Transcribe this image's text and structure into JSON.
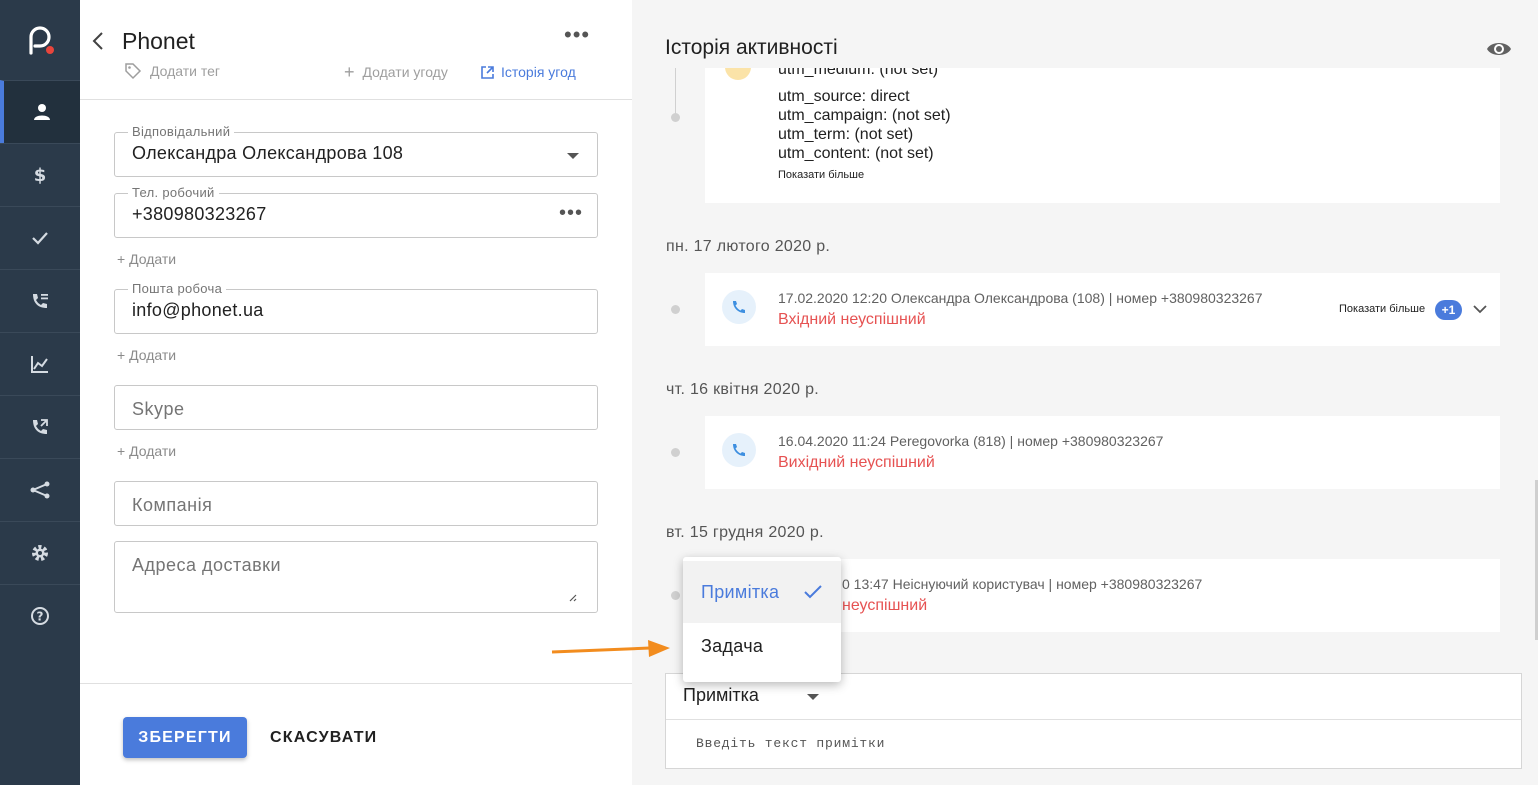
{
  "nav": {
    "items": [
      {
        "icon": "person-icon",
        "active": true
      },
      {
        "icon": "dollar-icon",
        "active": false
      },
      {
        "icon": "check-icon",
        "active": false
      },
      {
        "icon": "call-list-icon",
        "active": false
      },
      {
        "icon": "chart-icon",
        "active": false
      },
      {
        "icon": "call-forward-icon",
        "active": false
      },
      {
        "icon": "branch-icon",
        "active": false
      },
      {
        "icon": "gear-icon",
        "active": false
      },
      {
        "icon": "help-icon",
        "active": false
      }
    ],
    "accent": "#4a7bdc",
    "background": "#2b3a4a"
  },
  "contact": {
    "title": "Phonet",
    "add_tag": "Додати тег",
    "add_deal": "Додати угоду",
    "deal_history": "Історія угод",
    "responsible_label": "Відповідальний",
    "responsible_value": "Олександра Олександрова 108",
    "phone_label": "Тел. робочий",
    "phone_value": "+380980323267",
    "add_label": "Додати",
    "email_label": "Пошта робоча",
    "email_value": "info@phonet.ua",
    "skype_placeholder": "Skype",
    "company_placeholder": "Компанія",
    "address_placeholder": "Адреса доставки",
    "save": "ЗБЕРЕГТИ",
    "cancel": "СКАСУВАТИ"
  },
  "activity": {
    "title": "Історія активності",
    "utm": {
      "partial": "utm_medium: (not set)",
      "lines": [
        "utm_source: direct",
        "utm_campaign: (not set)",
        "utm_term: (not set)",
        "utm_content: (not set)"
      ],
      "show_more": "Показати більше"
    },
    "groups": [
      {
        "date": "пн. 17 лютого 2020 р.",
        "meta": "17.02.2020 12:20 Олександра Олександрова (108) | номер +380980323267",
        "status": "Вхідний неуспішний",
        "show_more": "Показати більше",
        "badge": "+1"
      },
      {
        "date": "чт. 16 квітня 2020 р.",
        "meta": "16.04.2020 11:24 Peregovorka (818) | номер +380980323267",
        "status": "Вихідний неуспішний"
      },
      {
        "date": "вт. 15 грудня 2020 р.",
        "meta": "0 13:47 Неіснуючий користувач | номер +380980323267",
        "status": "неуспішний"
      }
    ],
    "status_color": "#e65252"
  },
  "composer": {
    "selected_type": "Примітка",
    "placeholder": "Введіть текст примітки",
    "options": [
      "Примітка",
      "Задача"
    ]
  }
}
